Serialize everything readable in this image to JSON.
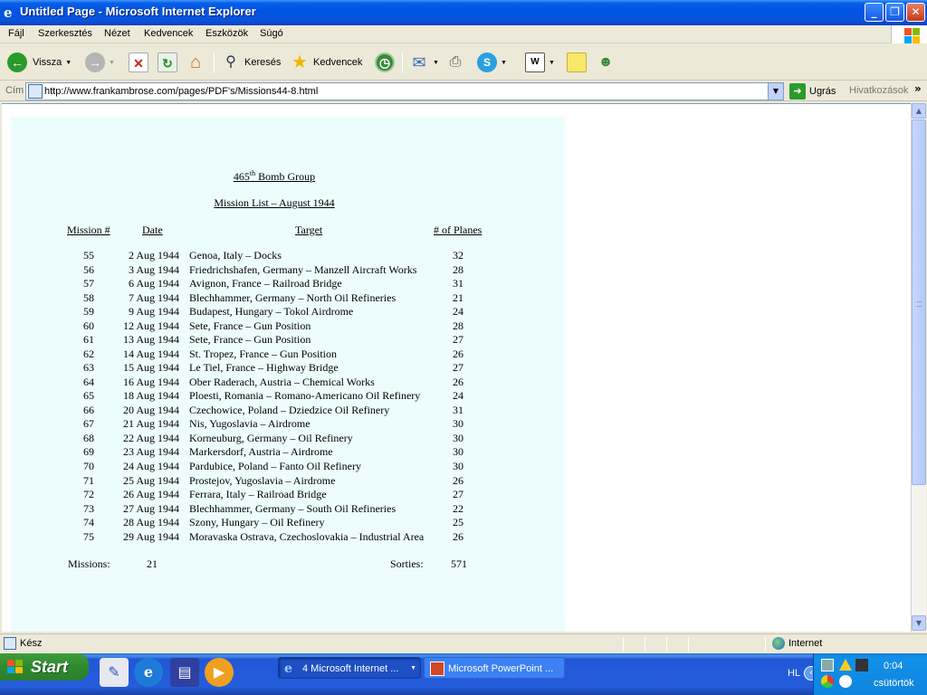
{
  "window": {
    "title": "Untitled Page - Microsoft Internet Explorer",
    "minimize_glyph": "_",
    "maximize_glyph": "❐",
    "close_glyph": "✕"
  },
  "menu": [
    "Fájl",
    "Szerkesztés",
    "Nézet",
    "Kedvencek",
    "Eszközök",
    "Súgó"
  ],
  "toolbar": {
    "back_label": "Vissza",
    "search_label": "Keresés",
    "favorites_label": "Kedvencek"
  },
  "address": {
    "label": "Cím",
    "url": "http://www.frankambrose.com/pages/PDF's/Missions44-8.html",
    "go_label": "Ugrás",
    "links_label": "Hivatkozások"
  },
  "document": {
    "group_title": "465",
    "group_title_sup": "th",
    "group_title_rest": " Bomb Group",
    "list_title": "Mission List – August 1944",
    "headers": {
      "mission": "Mission #",
      "date": "Date",
      "target": "Target",
      "planes": "# of Planes"
    },
    "missions": [
      {
        "num": "55",
        "date": "2 Aug 1944",
        "target": "Genoa, Italy – Docks",
        "planes": "32"
      },
      {
        "num": "56",
        "date": "3 Aug 1944",
        "target": "Friedrichshafen, Germany – Manzell Aircraft Works",
        "planes": "28"
      },
      {
        "num": "57",
        "date": "6 Aug 1944",
        "target": "Avignon, France – Railroad Bridge",
        "planes": "31"
      },
      {
        "num": "58",
        "date": "7 Aug 1944",
        "target": "Blechhammer, Germany – North Oil Refineries",
        "planes": "21"
      },
      {
        "num": "59",
        "date": "9 Aug 1944",
        "target": "Budapest, Hungary – Tokol Airdrome",
        "planes": "24"
      },
      {
        "num": "60",
        "date": "12 Aug 1944",
        "target": "Sete, France – Gun Position",
        "planes": "28"
      },
      {
        "num": "61",
        "date": "13 Aug 1944",
        "target": "Sete, France – Gun Position",
        "planes": "27"
      },
      {
        "num": "62",
        "date": "14 Aug 1944",
        "target": "St. Tropez, France – Gun Position",
        "planes": "26"
      },
      {
        "num": "63",
        "date": "15 Aug 1944",
        "target": "Le Tiel, France – Highway Bridge",
        "planes": "27"
      },
      {
        "num": "64",
        "date": "16 Aug 1944",
        "target": "Ober Raderach, Austria – Chemical Works",
        "planes": "26"
      },
      {
        "num": "65",
        "date": "18 Aug 1944",
        "target": "Ploesti, Romania – Romano-Americano Oil Refinery",
        "planes": "24"
      },
      {
        "num": "66",
        "date": "20 Aug 1944",
        "target": "Czechowice, Poland – Dziedzice Oil Refinery",
        "planes": "31"
      },
      {
        "num": "67",
        "date": "21 Aug 1944",
        "target": "Nis, Yugoslavia – Airdrome",
        "planes": "30"
      },
      {
        "num": "68",
        "date": "22 Aug 1944",
        "target": "Korneuburg, Germany – Oil Refinery",
        "planes": "30"
      },
      {
        "num": "69",
        "date": "23 Aug 1944",
        "target": "Markersdorf, Austria – Airdrome",
        "planes": "30"
      },
      {
        "num": "70",
        "date": "24 Aug 1944",
        "target": "Pardubice, Poland – Fanto Oil Refinery",
        "planes": "30"
      },
      {
        "num": "71",
        "date": "25 Aug 1944",
        "target": "Prostejov, Yugoslavia – Airdrome",
        "planes": "26"
      },
      {
        "num": "72",
        "date": "26 Aug 1944",
        "target": "Ferrara, Italy – Railroad Bridge",
        "planes": "27"
      },
      {
        "num": "73",
        "date": "27 Aug 1944",
        "target": "Blechhammer, Germany – South Oil Refineries",
        "planes": "22"
      },
      {
        "num": "74",
        "date": "28 Aug 1944",
        "target": "Szony, Hungary – Oil Refinery",
        "planes": "25"
      },
      {
        "num": "75",
        "date": "29 Aug 1944",
        "target": "Moravaska Ostrava, Czechoslovakia – Industrial Area",
        "planes": "26"
      }
    ],
    "summary": {
      "missions_label": "Missions:",
      "missions_value": "21",
      "sorties_label": "Sorties:",
      "sorties_value": "571"
    }
  },
  "status": {
    "text": "Kész",
    "zone": "Internet"
  },
  "taskbar": {
    "start_label": "Start",
    "tasks": [
      {
        "label": "4 Microsoft Internet ..."
      },
      {
        "label": "Microsoft PowerPoint ..."
      }
    ],
    "language": "HL",
    "time": "0:04",
    "day": "csütörtök"
  },
  "colors": {
    "doc_background": "#edfdfe",
    "titlebar_blue": "#0054e3",
    "start_green": "#3c9d3c"
  }
}
